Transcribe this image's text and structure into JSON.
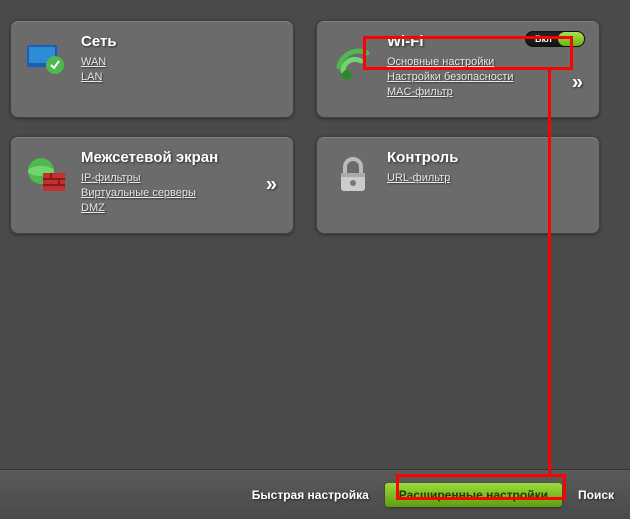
{
  "tiles": {
    "network": {
      "title": "Сеть",
      "links": [
        "WAN",
        "LAN"
      ]
    },
    "wifi": {
      "title": "Wi-Fi",
      "toggle_label": "Вкл",
      "links": [
        "Основные настройки",
        "Настройки безопасности",
        "MAC-фильтр"
      ]
    },
    "firewall": {
      "title": "Межсетевой экран",
      "links": [
        "IP-фильтры",
        "Виртуальные серверы",
        "DMZ"
      ]
    },
    "control": {
      "title": "Контроль",
      "links": [
        "URL-фильтр"
      ]
    }
  },
  "footer": {
    "quick": "Быстрая настройка",
    "advanced": "Расширенные настройки",
    "search": "Поиск"
  }
}
